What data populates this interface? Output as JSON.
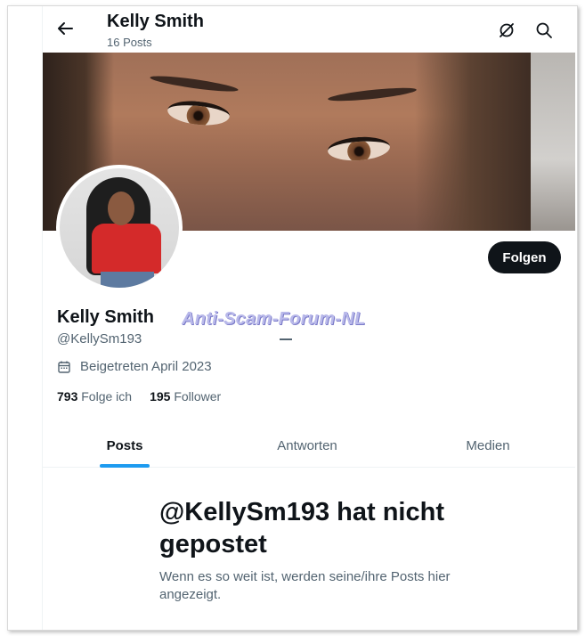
{
  "header": {
    "title": "Kelly Smith",
    "post_count": "16 Posts"
  },
  "profile": {
    "name": "Kelly Smith",
    "handle": "@KellySm193",
    "joined": "Beigetreten April 2023",
    "following_count": "793",
    "following_label": "Folge ich",
    "followers_count": "195",
    "followers_label": "Follower",
    "follow_label": "Folgen"
  },
  "watermark": "Anti-Scam-Forum-NL",
  "tabs": [
    {
      "label": "Posts",
      "active": true
    },
    {
      "label": "Antworten",
      "active": false
    },
    {
      "label": "Medien",
      "active": false
    }
  ],
  "empty_state": {
    "title": "@KellySm193 hat nicht gepostet",
    "text": "Wenn es so weit ist, werden seine/ihre Posts hier angezeigt."
  },
  "icons": {
    "back": "arrow-left-icon",
    "grok": "grok-slash-icon",
    "search": "search-icon",
    "calendar": "calendar-icon"
  },
  "colors": {
    "accent": "#1d9bf0",
    "text": "#0f1419",
    "secondary": "#536471",
    "button": "#0f1419"
  }
}
